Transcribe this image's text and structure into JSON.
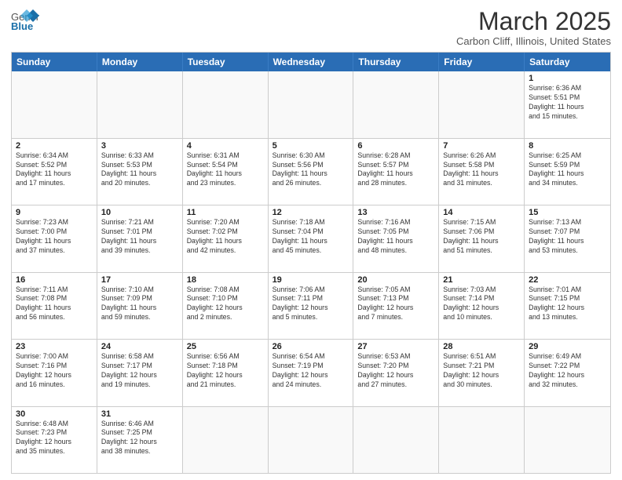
{
  "header": {
    "logo_general": "General",
    "logo_blue": "Blue",
    "month_title": "March 2025",
    "location": "Carbon Cliff, Illinois, United States"
  },
  "weekdays": [
    "Sunday",
    "Monday",
    "Tuesday",
    "Wednesday",
    "Thursday",
    "Friday",
    "Saturday"
  ],
  "rows": [
    [
      {
        "day": "",
        "info": ""
      },
      {
        "day": "",
        "info": ""
      },
      {
        "day": "",
        "info": ""
      },
      {
        "day": "",
        "info": ""
      },
      {
        "day": "",
        "info": ""
      },
      {
        "day": "",
        "info": ""
      },
      {
        "day": "1",
        "info": "Sunrise: 6:36 AM\nSunset: 5:51 PM\nDaylight: 11 hours\nand 15 minutes."
      }
    ],
    [
      {
        "day": "2",
        "info": "Sunrise: 6:34 AM\nSunset: 5:52 PM\nDaylight: 11 hours\nand 17 minutes."
      },
      {
        "day": "3",
        "info": "Sunrise: 6:33 AM\nSunset: 5:53 PM\nDaylight: 11 hours\nand 20 minutes."
      },
      {
        "day": "4",
        "info": "Sunrise: 6:31 AM\nSunset: 5:54 PM\nDaylight: 11 hours\nand 23 minutes."
      },
      {
        "day": "5",
        "info": "Sunrise: 6:30 AM\nSunset: 5:56 PM\nDaylight: 11 hours\nand 26 minutes."
      },
      {
        "day": "6",
        "info": "Sunrise: 6:28 AM\nSunset: 5:57 PM\nDaylight: 11 hours\nand 28 minutes."
      },
      {
        "day": "7",
        "info": "Sunrise: 6:26 AM\nSunset: 5:58 PM\nDaylight: 11 hours\nand 31 minutes."
      },
      {
        "day": "8",
        "info": "Sunrise: 6:25 AM\nSunset: 5:59 PM\nDaylight: 11 hours\nand 34 minutes."
      }
    ],
    [
      {
        "day": "9",
        "info": "Sunrise: 7:23 AM\nSunset: 7:00 PM\nDaylight: 11 hours\nand 37 minutes."
      },
      {
        "day": "10",
        "info": "Sunrise: 7:21 AM\nSunset: 7:01 PM\nDaylight: 11 hours\nand 39 minutes."
      },
      {
        "day": "11",
        "info": "Sunrise: 7:20 AM\nSunset: 7:02 PM\nDaylight: 11 hours\nand 42 minutes."
      },
      {
        "day": "12",
        "info": "Sunrise: 7:18 AM\nSunset: 7:04 PM\nDaylight: 11 hours\nand 45 minutes."
      },
      {
        "day": "13",
        "info": "Sunrise: 7:16 AM\nSunset: 7:05 PM\nDaylight: 11 hours\nand 48 minutes."
      },
      {
        "day": "14",
        "info": "Sunrise: 7:15 AM\nSunset: 7:06 PM\nDaylight: 11 hours\nand 51 minutes."
      },
      {
        "day": "15",
        "info": "Sunrise: 7:13 AM\nSunset: 7:07 PM\nDaylight: 11 hours\nand 53 minutes."
      }
    ],
    [
      {
        "day": "16",
        "info": "Sunrise: 7:11 AM\nSunset: 7:08 PM\nDaylight: 11 hours\nand 56 minutes."
      },
      {
        "day": "17",
        "info": "Sunrise: 7:10 AM\nSunset: 7:09 PM\nDaylight: 11 hours\nand 59 minutes."
      },
      {
        "day": "18",
        "info": "Sunrise: 7:08 AM\nSunset: 7:10 PM\nDaylight: 12 hours\nand 2 minutes."
      },
      {
        "day": "19",
        "info": "Sunrise: 7:06 AM\nSunset: 7:11 PM\nDaylight: 12 hours\nand 5 minutes."
      },
      {
        "day": "20",
        "info": "Sunrise: 7:05 AM\nSunset: 7:13 PM\nDaylight: 12 hours\nand 7 minutes."
      },
      {
        "day": "21",
        "info": "Sunrise: 7:03 AM\nSunset: 7:14 PM\nDaylight: 12 hours\nand 10 minutes."
      },
      {
        "day": "22",
        "info": "Sunrise: 7:01 AM\nSunset: 7:15 PM\nDaylight: 12 hours\nand 13 minutes."
      }
    ],
    [
      {
        "day": "23",
        "info": "Sunrise: 7:00 AM\nSunset: 7:16 PM\nDaylight: 12 hours\nand 16 minutes."
      },
      {
        "day": "24",
        "info": "Sunrise: 6:58 AM\nSunset: 7:17 PM\nDaylight: 12 hours\nand 19 minutes."
      },
      {
        "day": "25",
        "info": "Sunrise: 6:56 AM\nSunset: 7:18 PM\nDaylight: 12 hours\nand 21 minutes."
      },
      {
        "day": "26",
        "info": "Sunrise: 6:54 AM\nSunset: 7:19 PM\nDaylight: 12 hours\nand 24 minutes."
      },
      {
        "day": "27",
        "info": "Sunrise: 6:53 AM\nSunset: 7:20 PM\nDaylight: 12 hours\nand 27 minutes."
      },
      {
        "day": "28",
        "info": "Sunrise: 6:51 AM\nSunset: 7:21 PM\nDaylight: 12 hours\nand 30 minutes."
      },
      {
        "day": "29",
        "info": "Sunrise: 6:49 AM\nSunset: 7:22 PM\nDaylight: 12 hours\nand 32 minutes."
      }
    ],
    [
      {
        "day": "30",
        "info": "Sunrise: 6:48 AM\nSunset: 7:23 PM\nDaylight: 12 hours\nand 35 minutes."
      },
      {
        "day": "31",
        "info": "Sunrise: 6:46 AM\nSunset: 7:25 PM\nDaylight: 12 hours\nand 38 minutes."
      },
      {
        "day": "",
        "info": ""
      },
      {
        "day": "",
        "info": ""
      },
      {
        "day": "",
        "info": ""
      },
      {
        "day": "",
        "info": ""
      },
      {
        "day": "",
        "info": ""
      }
    ]
  ]
}
